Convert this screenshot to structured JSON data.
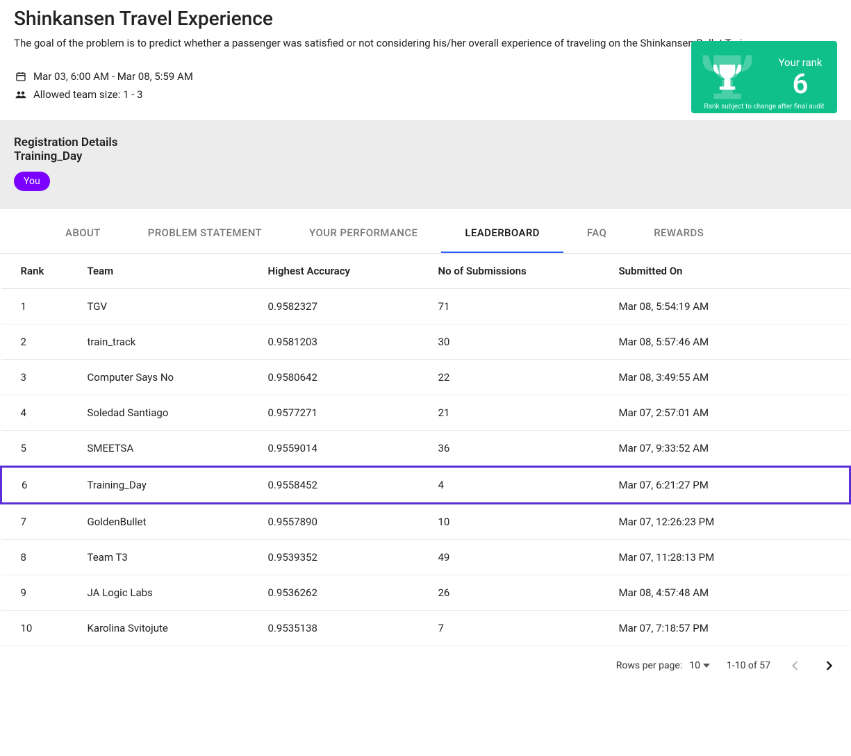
{
  "header": {
    "title": "Shinkansen Travel Experience",
    "description": "The goal of the problem is to predict whether a passenger was satisfied or not considering his/her overall experience of traveling on the Shinkansen Bullet Train.",
    "date_range": "Mar 03, 6:00 AM - Mar 08, 5:59 AM",
    "team_size": "Allowed team size: 1 - 3"
  },
  "rank_card": {
    "label": "Your rank",
    "value": "6",
    "note": "Rank subject to change after final audit"
  },
  "registration": {
    "heading": "Registration Details",
    "team_name": "Training_Day",
    "you_label": "You"
  },
  "tabs": [
    {
      "label": "ABOUT",
      "active": false
    },
    {
      "label": "PROBLEM STATEMENT",
      "active": false
    },
    {
      "label": "YOUR PERFORMANCE",
      "active": false
    },
    {
      "label": "LEADERBOARD",
      "active": true
    },
    {
      "label": "FAQ",
      "active": false
    },
    {
      "label": "REWARDS",
      "active": false
    }
  ],
  "table": {
    "columns": {
      "rank": "Rank",
      "team": "Team",
      "accuracy": "Highest Accuracy",
      "submissions": "No of Submissions",
      "submitted": "Submitted On"
    },
    "rows": [
      {
        "rank": "1",
        "team": "TGV",
        "accuracy": "0.9582327",
        "submissions": "71",
        "submitted": "Mar 08, 5:54:19 AM",
        "highlight": false
      },
      {
        "rank": "2",
        "team": "train_track",
        "accuracy": "0.9581203",
        "submissions": "30",
        "submitted": "Mar 08, 5:57:46 AM",
        "highlight": false
      },
      {
        "rank": "3",
        "team": "Computer Says No",
        "accuracy": "0.9580642",
        "submissions": "22",
        "submitted": "Mar 08, 3:49:55 AM",
        "highlight": false
      },
      {
        "rank": "4",
        "team": "Soledad Santiago",
        "accuracy": "0.9577271",
        "submissions": "21",
        "submitted": "Mar 07, 2:57:01 AM",
        "highlight": false
      },
      {
        "rank": "5",
        "team": "SMEETSA",
        "accuracy": "0.9559014",
        "submissions": "36",
        "submitted": "Mar 07, 9:33:52 AM",
        "highlight": false
      },
      {
        "rank": "6",
        "team": "Training_Day",
        "accuracy": "0.9558452",
        "submissions": "4",
        "submitted": "Mar 07, 6:21:27 PM",
        "highlight": true
      },
      {
        "rank": "7",
        "team": "GoldenBullet",
        "accuracy": "0.9557890",
        "submissions": "10",
        "submitted": "Mar 07, 12:26:23 PM",
        "highlight": false
      },
      {
        "rank": "8",
        "team": "Team T3",
        "accuracy": "0.9539352",
        "submissions": "49",
        "submitted": "Mar 07, 11:28:13 PM",
        "highlight": false
      },
      {
        "rank": "9",
        "team": "JA Logic Labs",
        "accuracy": "0.9536262",
        "submissions": "26",
        "submitted": "Mar 08, 4:57:48 AM",
        "highlight": false
      },
      {
        "rank": "10",
        "team": "Karolina Svitojute",
        "accuracy": "0.9535138",
        "submissions": "7",
        "submitted": "Mar 07, 7:18:57 PM",
        "highlight": false
      }
    ]
  },
  "pagination": {
    "rows_label": "Rows per page:",
    "rows_value": "10",
    "range": "1-10 of 57"
  }
}
